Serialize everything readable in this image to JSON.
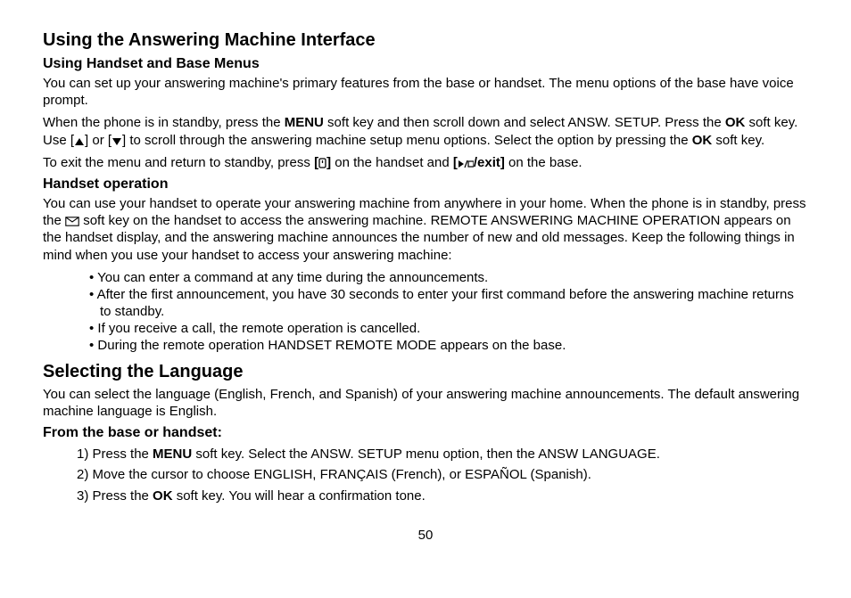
{
  "section1": {
    "title": "Using the Answering Machine Interface",
    "sub1": {
      "heading": "Using Handset and Base Menus",
      "p1": "You can set up your answering machine's primary features from the base or handset. The menu options of the base have voice prompt.",
      "p2a": "When the phone is in standby, press the ",
      "p2b_bold": "MENU",
      "p2c": " soft key and then scroll down and select ANSW. SETUP. Press the ",
      "p2d_bold": "OK",
      "p2e": " soft key. Use [",
      "p2f": "] or [",
      "p2g": "] to scroll through the answering machine setup menu options. Select the option by pressing the ",
      "p2h_bold": "OK",
      "p2i": " soft key.",
      "p3a": "To exit the menu and return to standby, press ",
      "p3b_icon_label": "[end-icon]",
      "p3c": " on the handset and ",
      "p3d_bold": "[",
      "p3e_bold": "/exit]",
      "p3f": " on the base."
    },
    "sub2": {
      "heading": "Handset operation",
      "p1a": "You can use your handset to operate your answering machine from anywhere in your home. When the phone is in standby, press the ",
      "p1b": " soft key on the handset to access the answering machine. REMOTE ANSWERING MACHINE OPERATION appears on the handset display, and the answering machine announces the number of new and old messages. Keep the following things in mind when you use your handset to access your answering machine:",
      "bullets": [
        "You can enter a command at any time during the announcements.",
        "After the first announcement, you have 30 seconds to enter your first command before the answering machine returns to standby.",
        "If you receive a call, the remote operation is cancelled.",
        "During the remote operation HANDSET REMOTE MODE appears on the base."
      ]
    }
  },
  "section2": {
    "title": "Selecting the Language",
    "p1": "You can select the language (English, French, and Spanish) of your answering machine announcements. The default answering machine language is English.",
    "sub1": {
      "heading": "From the base or handset:",
      "steps": {
        "s1a": "Press the ",
        "s1b_bold": "MENU",
        "s1c": " soft key. Select the ANSW. SETUP menu option, then the ANSW LANGUAGE.",
        "s2": "Move the cursor to choose ENGLISH, FRANÇAIS (French), or ESPAÑOL (Spanish).",
        "s3a": "Press the ",
        "s3b_bold": "OK",
        "s3c": " soft key. You will hear a confirmation tone."
      }
    }
  },
  "page_number": "50"
}
